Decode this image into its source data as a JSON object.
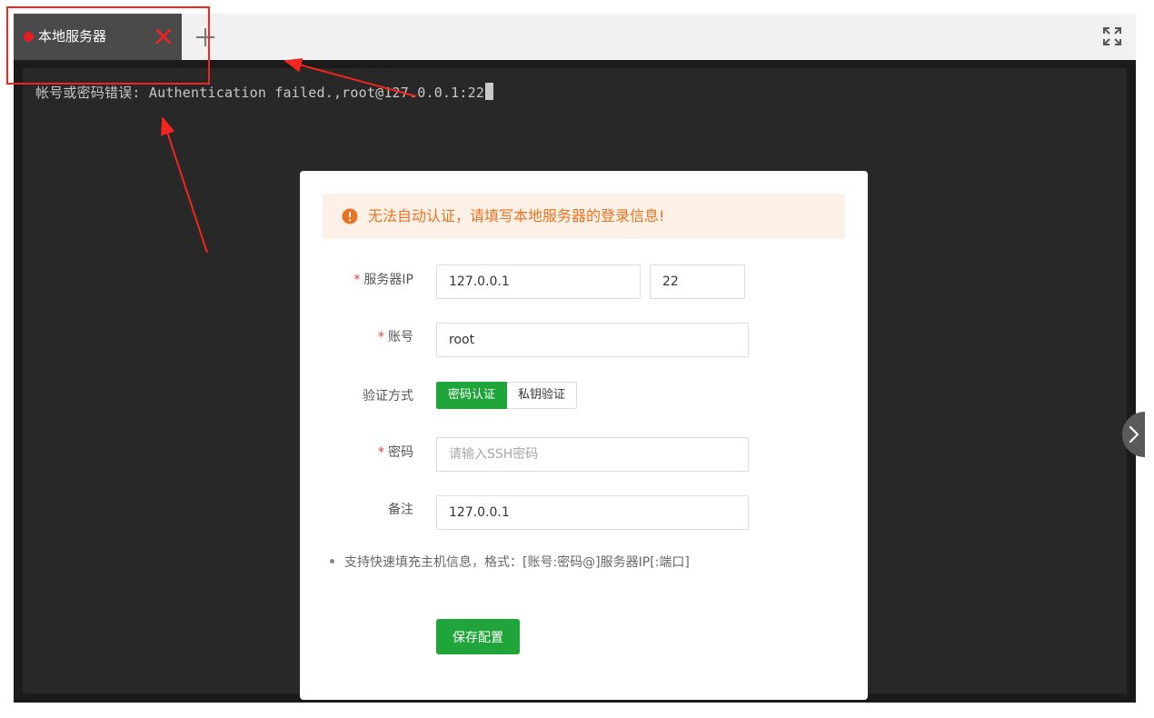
{
  "tab": {
    "label": "本地服务器",
    "status_color": "#e81d1d",
    "close_icon": "close-icon",
    "add_icon": "plus-icon"
  },
  "toolbar": {
    "fullscreen_icon": "fullscreen-icon"
  },
  "terminal": {
    "output": "帐号或密码错误: Authentication failed.,root@127.0.0.1:22"
  },
  "dialog": {
    "alert_text": "无法自动认证，请填写本地服务器的登录信息!",
    "alert_color": "#ea7321",
    "server_ip_label": "服务器IP",
    "server_ip_value": "127.0.0.1",
    "port_value": "22",
    "account_label": "账号",
    "account_value": "root",
    "auth_label": "验证方式",
    "auth_options": [
      "密码认证",
      "私钥验证"
    ],
    "auth_selected": "密码认证",
    "password_label": "密码",
    "password_placeholder": "请输入SSH密码",
    "remark_label": "备注",
    "remark_value": "127.0.0.1",
    "tip": "支持快速填充主机信息，格式：[账号:密码@]服务器IP[:端口]",
    "save_label": "保存配置",
    "accent_color": "#20a53a"
  }
}
